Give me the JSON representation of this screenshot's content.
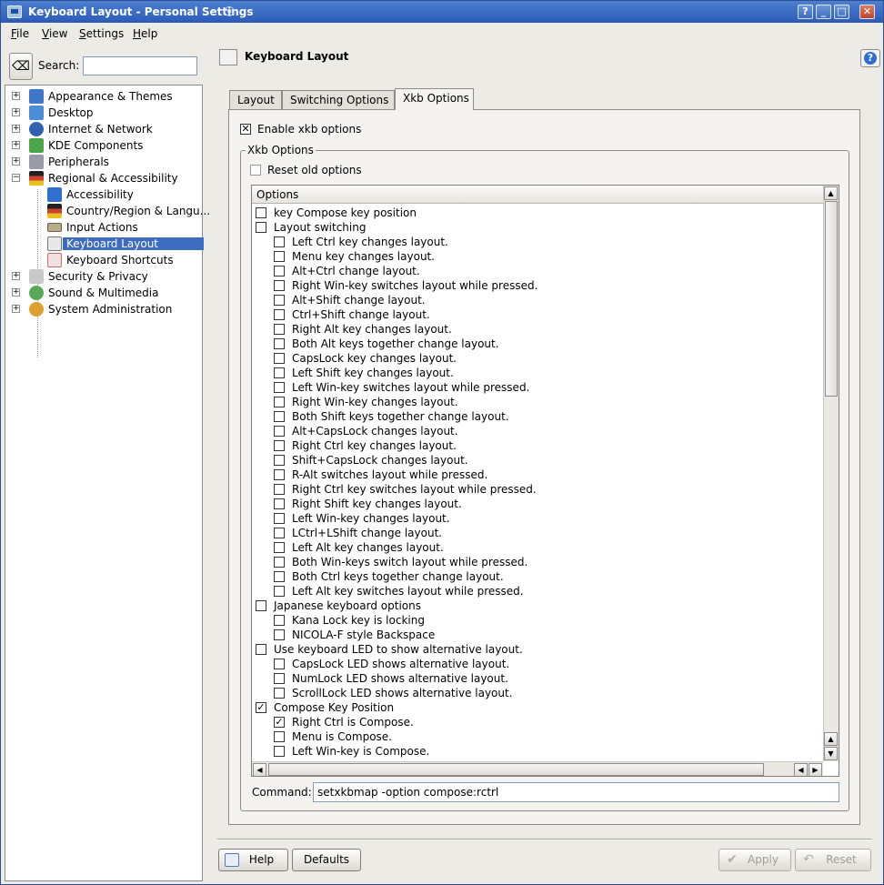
{
  "window": {
    "title": "Keyboard Layout - Personal Settings",
    "controls": [
      "?",
      "_",
      "□",
      "✕"
    ]
  },
  "menu": [
    "File",
    "View",
    "Settings",
    "Help"
  ],
  "search": {
    "label": "Search:",
    "value": ""
  },
  "sidebar": {
    "items": [
      {
        "label": "Appearance & Themes",
        "icon": "appearance-icon",
        "color": "#3f78c8"
      },
      {
        "label": "Desktop",
        "icon": "desktop-icon",
        "color": "#4a8fd6"
      },
      {
        "label": "Internet & Network",
        "icon": "globe-icon",
        "color": "#3060b0"
      },
      {
        "label": "KDE Components",
        "icon": "components-icon",
        "color": "#4aa84a"
      },
      {
        "label": "Peripherals",
        "icon": "mouse-icon",
        "color": "#9a9aa8"
      },
      {
        "label": "Regional & Accessibility",
        "icon": "flag-icon",
        "color": "#d04030"
      },
      {
        "label": "Accessibility",
        "icon": "accessibility-icon",
        "color": "#2f6fd0"
      },
      {
        "label": "Country/Region & Langu...",
        "icon": "flag-icon",
        "color": "#e0b020"
      },
      {
        "label": "Input Actions",
        "icon": "keyboard-icon",
        "color": "#b8ab88"
      },
      {
        "label": "Keyboard Layout",
        "icon": "keyboard-layout-icon",
        "color": "#cfcfcf"
      },
      {
        "label": "Keyboard Shortcuts",
        "icon": "shortcuts-icon",
        "color": "#d07070"
      },
      {
        "label": "Security & Privacy",
        "icon": "security-icon",
        "color": "#a0a0a0"
      },
      {
        "label": "Sound & Multimedia",
        "icon": "sound-icon",
        "color": "#58a858"
      },
      {
        "label": "System Administration",
        "icon": "system-icon",
        "color": "#e0a030"
      }
    ]
  },
  "page": {
    "title": "Keyboard Layout"
  },
  "tabs": [
    "Layout",
    "Switching Options",
    "Xkb Options"
  ],
  "xkb": {
    "enable_label": "Enable xkb options",
    "group_title": "Xkb Options",
    "reset_label": "Reset old options",
    "list_header": "Options",
    "options": [
      {
        "label": "key Compose key position",
        "level": 0,
        "checked": false
      },
      {
        "label": "Layout switching",
        "level": 0,
        "checked": false
      },
      {
        "label": "Left Ctrl key changes layout.",
        "level": 1,
        "checked": false
      },
      {
        "label": "Menu key changes layout.",
        "level": 1,
        "checked": false
      },
      {
        "label": "Alt+Ctrl change layout.",
        "level": 1,
        "checked": false
      },
      {
        "label": "Right Win-key switches layout while pressed.",
        "level": 1,
        "checked": false
      },
      {
        "label": "Alt+Shift change layout.",
        "level": 1,
        "checked": false
      },
      {
        "label": "Ctrl+Shift change layout.",
        "level": 1,
        "checked": false
      },
      {
        "label": "Right Alt key changes layout.",
        "level": 1,
        "checked": false
      },
      {
        "label": "Both Alt keys together change layout.",
        "level": 1,
        "checked": false
      },
      {
        "label": "CapsLock key changes layout.",
        "level": 1,
        "checked": false
      },
      {
        "label": "Left Shift key changes layout.",
        "level": 1,
        "checked": false
      },
      {
        "label": "Left Win-key switches layout while pressed.",
        "level": 1,
        "checked": false
      },
      {
        "label": "Right Win-key changes layout.",
        "level": 1,
        "checked": false
      },
      {
        "label": "Both Shift keys together change layout.",
        "level": 1,
        "checked": false
      },
      {
        "label": "Alt+CapsLock changes layout.",
        "level": 1,
        "checked": false
      },
      {
        "label": "Right Ctrl key changes layout.",
        "level": 1,
        "checked": false
      },
      {
        "label": "Shift+CapsLock changes layout.",
        "level": 1,
        "checked": false
      },
      {
        "label": "R-Alt switches layout while pressed.",
        "level": 1,
        "checked": false
      },
      {
        "label": "Right Ctrl key switches layout while pressed.",
        "level": 1,
        "checked": false
      },
      {
        "label": "Right Shift key changes layout.",
        "level": 1,
        "checked": false
      },
      {
        "label": "Left Win-key changes layout.",
        "level": 1,
        "checked": false
      },
      {
        "label": "LCtrl+LShift change layout.",
        "level": 1,
        "checked": false
      },
      {
        "label": "Left Alt key changes layout.",
        "level": 1,
        "checked": false
      },
      {
        "label": "Both Win-keys switch layout while pressed.",
        "level": 1,
        "checked": false
      },
      {
        "label": "Both Ctrl keys together change layout.",
        "level": 1,
        "checked": false
      },
      {
        "label": "Left Alt key switches layout while pressed.",
        "level": 1,
        "checked": false
      },
      {
        "label": "Japanese keyboard options",
        "level": 0,
        "checked": false
      },
      {
        "label": "Kana Lock key is locking",
        "level": 1,
        "checked": false
      },
      {
        "label": "NICOLA-F style Backspace",
        "level": 1,
        "checked": false
      },
      {
        "label": "Use keyboard LED to show alternative layout.",
        "level": 0,
        "checked": false
      },
      {
        "label": "CapsLock LED shows alternative layout.",
        "level": 1,
        "checked": false
      },
      {
        "label": "NumLock LED shows alternative layout.",
        "level": 1,
        "checked": false
      },
      {
        "label": "ScrollLock LED shows alternative layout.",
        "level": 1,
        "checked": false
      },
      {
        "label": "Compose Key Position",
        "level": 0,
        "checked": true
      },
      {
        "label": "Right Ctrl is Compose.",
        "level": 1,
        "checked": true
      },
      {
        "label": "Menu is Compose.",
        "level": 1,
        "checked": false
      },
      {
        "label": "Left Win-key is Compose.",
        "level": 1,
        "checked": false
      }
    ],
    "command_label": "Command:",
    "command_value": "setxkbmap -option compose:rctrl"
  },
  "buttons": {
    "help": "Help",
    "defaults": "Defaults",
    "apply": "Apply",
    "reset": "Reset"
  }
}
